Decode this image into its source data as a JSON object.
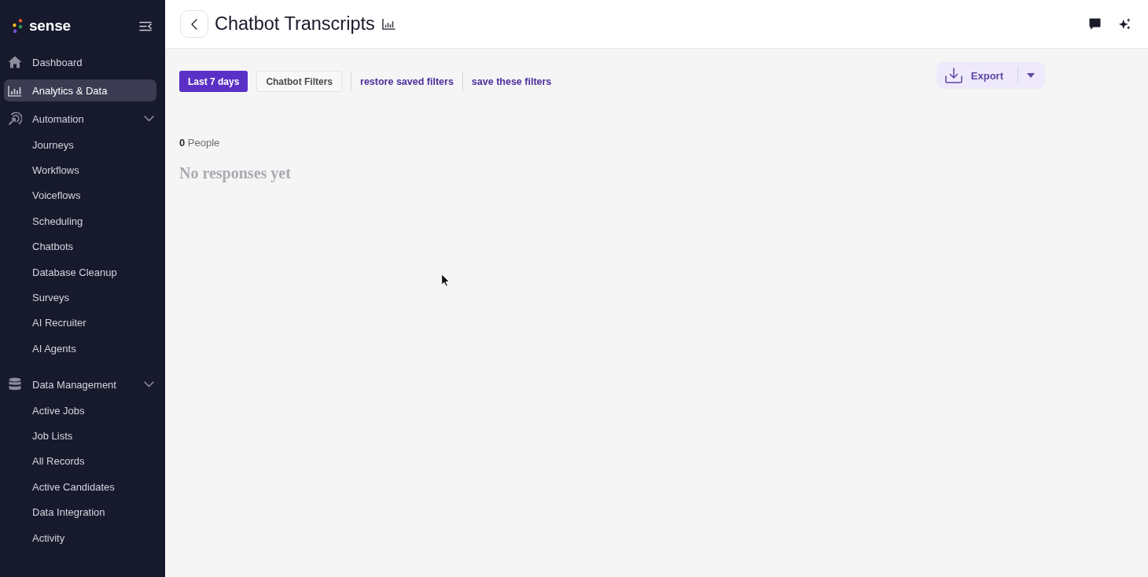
{
  "sidebar": {
    "logo": "sense",
    "items": [
      {
        "kind": "link",
        "label": "Dashboard",
        "selected": false
      },
      {
        "kind": "link",
        "label": "Analytics & Data",
        "selected": true
      },
      {
        "kind": "group",
        "label": "Automation",
        "selected": false,
        "expanded": true,
        "children": [
          {
            "label": "Journeys",
            "selected": false
          },
          {
            "label": "Workflows",
            "selected": false
          },
          {
            "label": "Voiceflows",
            "selected": false
          },
          {
            "label": "Scheduling",
            "selected": false
          },
          {
            "label": "Chatbots",
            "selected": false
          },
          {
            "label": "Database Cleanup",
            "selected": false
          },
          {
            "label": "Surveys",
            "selected": false
          },
          {
            "label": "AI Recruiter",
            "selected": false
          },
          {
            "label": "AI Agents",
            "selected": false
          }
        ]
      },
      {
        "kind": "group",
        "label": "Data Management",
        "selected": false,
        "expanded": true,
        "children": [
          {
            "label": "Active Jobs",
            "selected": false
          },
          {
            "label": "Job Lists",
            "selected": false
          },
          {
            "label": "All Records",
            "selected": false
          },
          {
            "label": "Active Candidates",
            "selected": false
          },
          {
            "label": "Data Integration",
            "selected": false
          },
          {
            "label": "Activity",
            "selected": false
          }
        ]
      }
    ]
  },
  "header": {
    "title": "Chatbot Transcripts"
  },
  "toolbar": {
    "date_range_button": "Last 7 days",
    "filters_button": "Chatbot Filters",
    "links": [
      "restore saved filters",
      "save these filters"
    ],
    "export_button": "Export"
  },
  "summary": {
    "people": "**0** People"
  },
  "empty_state": "No responses yet"
}
